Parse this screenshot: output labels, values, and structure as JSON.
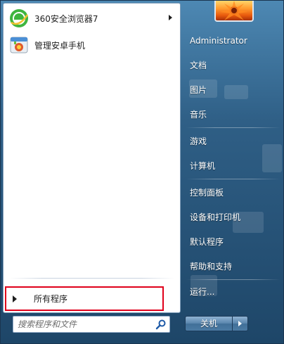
{
  "pinned": [
    {
      "label": "360安全浏览器7",
      "icon": "360-browser-icon",
      "has_submenu": true
    },
    {
      "label": "管理安卓手机",
      "icon": "android-manager-icon",
      "has_submenu": false
    }
  ],
  "all_programs_label": "所有程序",
  "search": {
    "placeholder": "搜索程序和文件"
  },
  "user_name": "Administrator",
  "right_items": {
    "documents": "文档",
    "pictures": "图片",
    "music": "音乐",
    "games": "游戏",
    "computer": "计算机",
    "control_panel": "控制面板",
    "devices_printers": "设备和打印机",
    "default_programs": "默认程序",
    "help_support": "帮助和支持",
    "run": "运行..."
  },
  "shutdown_label": "关机",
  "colors": {
    "highlight_border": "#e0001a",
    "accent": "#2f5f86"
  }
}
